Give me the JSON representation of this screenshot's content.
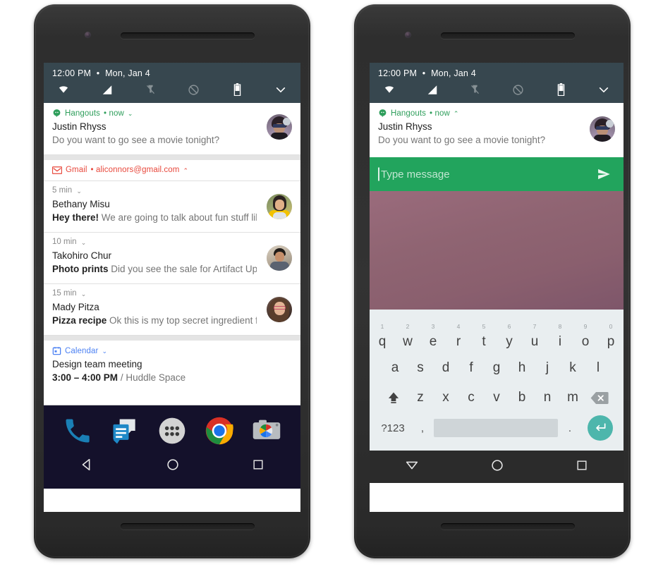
{
  "status_bar": {
    "time": "12:00 PM",
    "separator": "•",
    "date": "Mon, Jan 4",
    "icons": [
      "wifi-icon",
      "cell-signal-icon",
      "flashlight-off-icon",
      "dnd-off-icon",
      "battery-icon",
      "chevron-down-icon"
    ]
  },
  "left_phone": {
    "notifications": [
      {
        "app": "Hangouts",
        "meta": "• now",
        "expand": "⌄",
        "title": "Justin Rhyss",
        "text": "Do you want to go see a movie tonight?",
        "accent": "#2e9e5b",
        "icon": "hangouts-icon"
      }
    ],
    "gmail_group": {
      "app": "Gmail",
      "meta": "• aliconnors@gmail.com",
      "collapse": "⌃",
      "accent": "#e8483c",
      "icon": "gmail-icon",
      "items": [
        {
          "time": "5 min",
          "expand": "⌄",
          "title": "Bethany Misu",
          "subject": "Hey there!",
          "preview": " We are going to talk about fun stuff like..."
        },
        {
          "time": "10 min",
          "expand": "⌄",
          "title": "Takohiro Chur",
          "subject": "Photo prints",
          "preview": " Did you see the sale for Artifact Upri..."
        },
        {
          "time": "15 min",
          "expand": "⌄",
          "title": "Mady Pitza",
          "subject": "Pizza recipe",
          "preview": " Ok this is my top secret ingredient for..."
        }
      ]
    },
    "calendar": {
      "app": "Calendar",
      "expand": "⌄",
      "accent": "#4d82f3",
      "icon": "calendar-icon",
      "title": "Design team meeting",
      "text_time": "3:00 – 4:00 PM",
      "text_place": " / Huddle Space"
    },
    "dock": [
      "phone-icon",
      "messages-icon",
      "app-drawer-icon",
      "chrome-icon",
      "camera-icon"
    ],
    "navbar": [
      "back-triangle-icon",
      "home-circle-icon",
      "recents-square-icon"
    ]
  },
  "right_phone": {
    "notification": {
      "app": "Hangouts",
      "meta": "• now",
      "collapse": "⌃",
      "title": "Justin Rhyss",
      "text": "Do you want to go see a movie tonight?",
      "accent": "#2e9e5b",
      "icon": "hangouts-icon"
    },
    "reply": {
      "placeholder": "Type message",
      "send_icon": "send-icon",
      "background": "#22a45d"
    },
    "keyboard": {
      "row1": [
        {
          "letter": "q",
          "num": "1"
        },
        {
          "letter": "w",
          "num": "2"
        },
        {
          "letter": "e",
          "num": "3"
        },
        {
          "letter": "r",
          "num": "4"
        },
        {
          "letter": "t",
          "num": "5"
        },
        {
          "letter": "y",
          "num": "6"
        },
        {
          "letter": "u",
          "num": "7"
        },
        {
          "letter": "i",
          "num": "8"
        },
        {
          "letter": "o",
          "num": "9"
        },
        {
          "letter": "p",
          "num": "0"
        }
      ],
      "row2": [
        "a",
        "s",
        "d",
        "f",
        "g",
        "h",
        "j",
        "k",
        "l"
      ],
      "row3": [
        "z",
        "x",
        "c",
        "v",
        "b",
        "n",
        "m"
      ],
      "shift_icon": "shift-icon",
      "backspace_icon": "backspace-icon",
      "symbols_key": "?123",
      "comma_key": ",",
      "period_key": ".",
      "enter_icon": "enter-icon",
      "background": "#e9eef0",
      "enter_color": "#4db6ac"
    },
    "navbar": [
      "keyboard-dismiss-triangle-icon",
      "home-circle-icon",
      "recents-square-icon"
    ]
  }
}
